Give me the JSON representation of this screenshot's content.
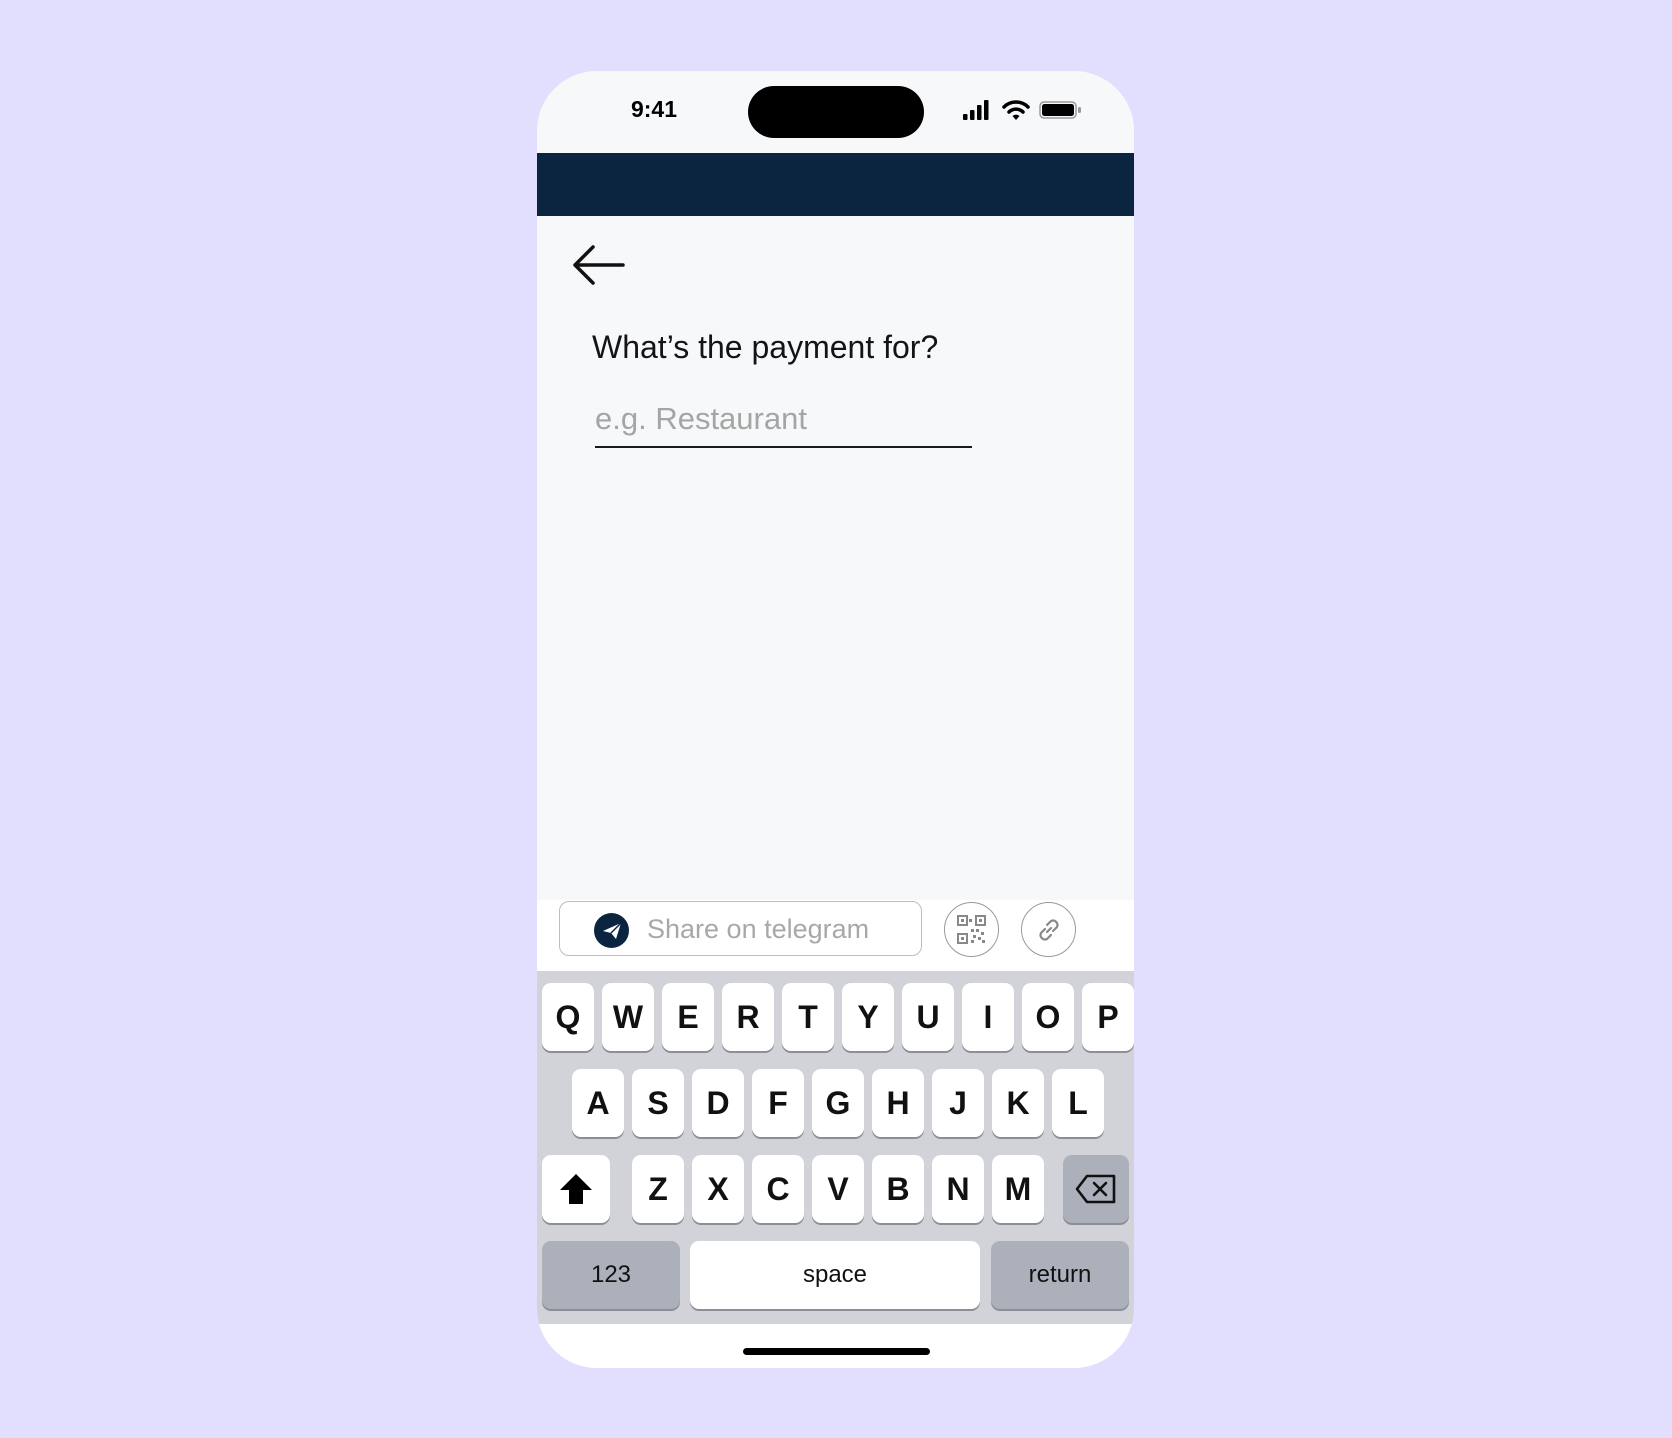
{
  "status_bar": {
    "time": "9:41"
  },
  "form": {
    "question": "What’s the payment for?",
    "input_placeholder": "e.g. Restaurant",
    "input_value": ""
  },
  "share_bar": {
    "telegram_label": "Share on telegram",
    "icons": [
      "telegram-icon",
      "qr-code-icon",
      "link-icon"
    ]
  },
  "keyboard": {
    "row1": [
      "Q",
      "W",
      "E",
      "R",
      "T",
      "Y",
      "U",
      "I",
      "O",
      "P"
    ],
    "row2": [
      "A",
      "S",
      "D",
      "F",
      "G",
      "H",
      "J",
      "K",
      "L"
    ],
    "row3": [
      "Z",
      "X",
      "C",
      "V",
      "B",
      "N",
      "M"
    ],
    "numbers_label": "123",
    "space_label": "space",
    "return_label": "return"
  },
  "colors": {
    "background": "#e2defd",
    "header": "#0b2440",
    "screen": "#f7f8fa",
    "keyboard": "#d1d3d9"
  }
}
